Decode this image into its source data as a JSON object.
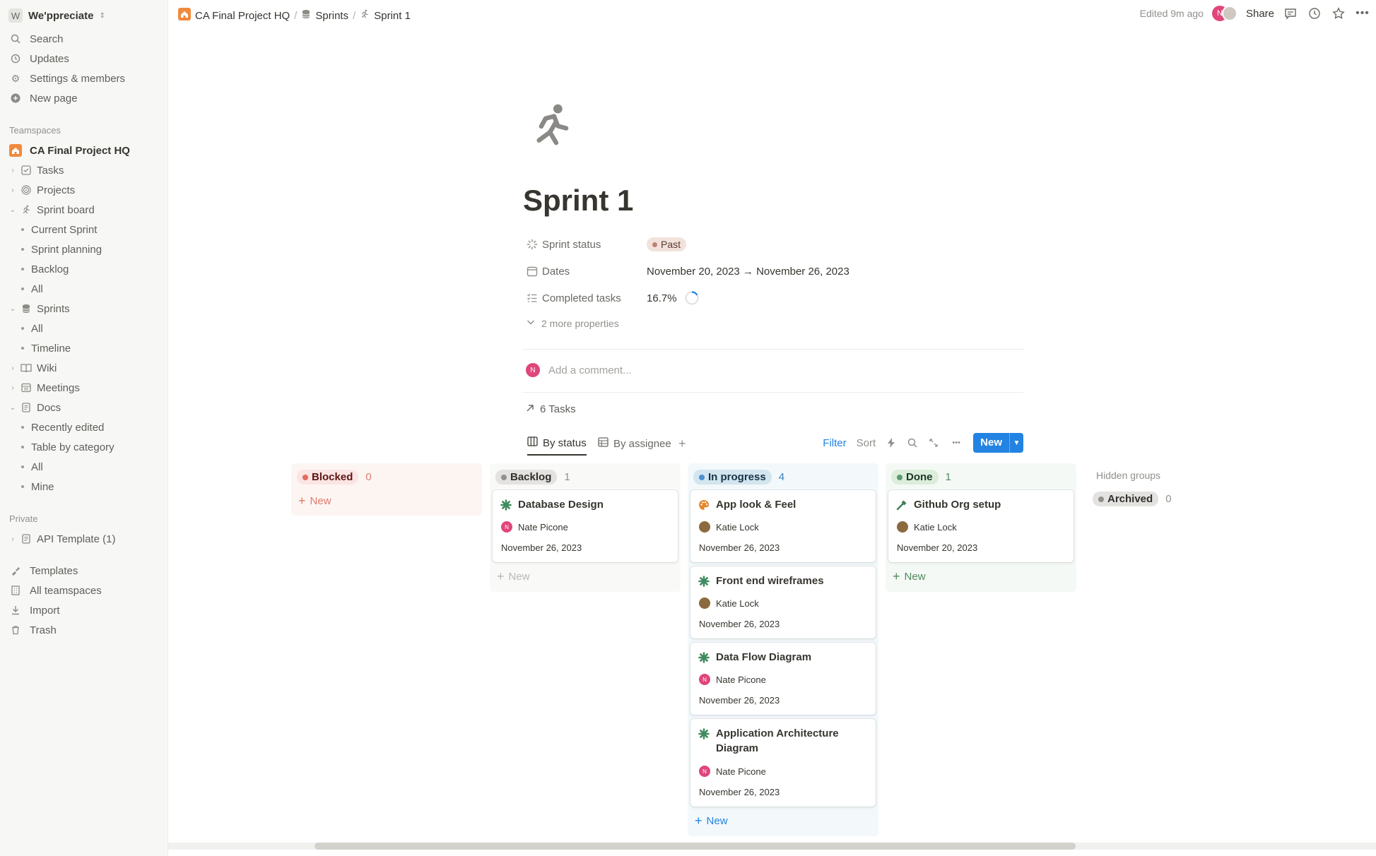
{
  "workspace": {
    "badge": "W",
    "name": "We'ppreciate"
  },
  "sidebar": {
    "top_items": [
      {
        "label": "Search",
        "icon": "search-icon"
      },
      {
        "label": "Updates",
        "icon": "clock-icon"
      },
      {
        "label": "Settings & members",
        "icon": "gear-icon"
      },
      {
        "label": "New page",
        "icon": "plus-circle-icon"
      }
    ],
    "teamspaces_label": "Teamspaces",
    "teamspace_name": "CA Final Project HQ",
    "tree": [
      {
        "label": "Tasks",
        "icon": "checkbox-icon",
        "level": 0,
        "expanded": false
      },
      {
        "label": "Projects",
        "icon": "target-icon",
        "level": 0,
        "expanded": false
      },
      {
        "label": "Sprint board",
        "icon": "runner-icon",
        "level": 0,
        "expanded": true
      },
      {
        "label": "Current Sprint",
        "level": 1
      },
      {
        "label": "Sprint planning",
        "level": 1
      },
      {
        "label": "Backlog",
        "level": 1
      },
      {
        "label": "All",
        "level": 1
      },
      {
        "label": "Sprints",
        "icon": "database-icon",
        "level": 0,
        "expanded": true
      },
      {
        "label": "All",
        "level": 1
      },
      {
        "label": "Timeline",
        "level": 1
      },
      {
        "label": "Wiki",
        "icon": "book-icon",
        "level": 0,
        "expanded": false
      },
      {
        "label": "Meetings",
        "icon": "calendar-table-icon",
        "level": 0,
        "expanded": false
      },
      {
        "label": "Docs",
        "icon": "document-icon",
        "level": 0,
        "expanded": true
      },
      {
        "label": "Recently edited",
        "level": 1
      },
      {
        "label": "Table by category",
        "level": 1
      },
      {
        "label": "All",
        "level": 1
      },
      {
        "label": "Mine",
        "level": 1
      }
    ],
    "private_label": "Private",
    "private_items": [
      {
        "label": "API Template (1)",
        "icon": "document-icon"
      }
    ],
    "bottom_items": [
      {
        "label": "Templates",
        "icon": "templates-icon"
      },
      {
        "label": "All teamspaces",
        "icon": "building-icon"
      },
      {
        "label": "Import",
        "icon": "import-icon"
      },
      {
        "label": "Trash",
        "icon": "trash-icon"
      }
    ]
  },
  "topbar": {
    "breadcrumbs": [
      "CA Final Project HQ",
      "Sprints",
      "Sprint 1"
    ],
    "edited": "Edited 9m ago",
    "avatar_initial": "N",
    "share": "Share"
  },
  "page": {
    "title": "Sprint 1",
    "properties": [
      {
        "name": "Sprint status",
        "value": "Past"
      },
      {
        "name": "Dates",
        "value": "November 20, 2023 → November 26, 2023"
      },
      {
        "name": "Completed tasks",
        "value": "16.7%",
        "progress": 0.167
      }
    ],
    "more_properties": "2 more properties",
    "comment_placeholder": "Add a comment...",
    "comment_avatar": "N",
    "tasks_link": "6 Tasks"
  },
  "views": {
    "tabs": [
      "By status",
      "By assignee"
    ],
    "active_tab": 0,
    "filter": "Filter",
    "sort": "Sort",
    "new": "New"
  },
  "board": {
    "columns": [
      {
        "name": "Blocked",
        "count": "0",
        "dot": "#e16b5f",
        "tagbg": "#fbe4e4",
        "tagfg": "#5d1715",
        "colbg": "#fdf5f2",
        "countcolor": "#e07b6d",
        "newcolor": "#e07b6d",
        "new": "New",
        "cards": []
      },
      {
        "name": "Backlog",
        "count": "1",
        "dot": "#91908c",
        "tagbg": "#e3e2e0",
        "tagfg": "#32302c",
        "colbg": "#f9f9f8",
        "countcolor": "#91908c",
        "newcolor": "#b9b8b4",
        "new": "New",
        "cards": [
          {
            "title": "Database Design",
            "icon": "asterisk-icon",
            "person": "Nate Picone",
            "date": "November 26, 2023"
          }
        ]
      },
      {
        "name": "In progress",
        "count": "4",
        "dot": "#4c8fd1",
        "tagbg": "#d3e5ef",
        "tagfg": "#183347",
        "colbg": "#f3f8fb",
        "countcolor": "#3a7fc1",
        "newcolor": "#2383e2",
        "new": "New",
        "cards": [
          {
            "title": "App look & Feel",
            "icon": "palette-icon",
            "person": "Katie Lock",
            "date": "November 26, 2023"
          },
          {
            "title": "Front end wireframes",
            "icon": "asterisk-icon",
            "person": "Katie Lock",
            "date": "November 26, 2023"
          },
          {
            "title": "Data Flow Diagram",
            "icon": "asterisk-icon",
            "person": "Nate Picone",
            "date": "November 26, 2023"
          },
          {
            "title": "Application Architecture Diagram",
            "icon": "asterisk-icon",
            "person": "Nate Picone",
            "date": "November 26, 2023"
          }
        ]
      },
      {
        "name": "Done",
        "count": "1",
        "dot": "#5b9a6e",
        "tagbg": "#dbeddb",
        "tagfg": "#1c3829",
        "colbg": "#f5f9f5",
        "countcolor": "#4f8a5e",
        "newcolor": "#4f8a5e",
        "new": "New",
        "cards": [
          {
            "title": "Github Org setup",
            "icon": "hammer-icon",
            "person": "Katie Lock",
            "date": "November 20, 2023"
          }
        ]
      }
    ],
    "hidden_groups": "Hidden groups",
    "archived": {
      "name": "Archived",
      "count": "0"
    }
  }
}
